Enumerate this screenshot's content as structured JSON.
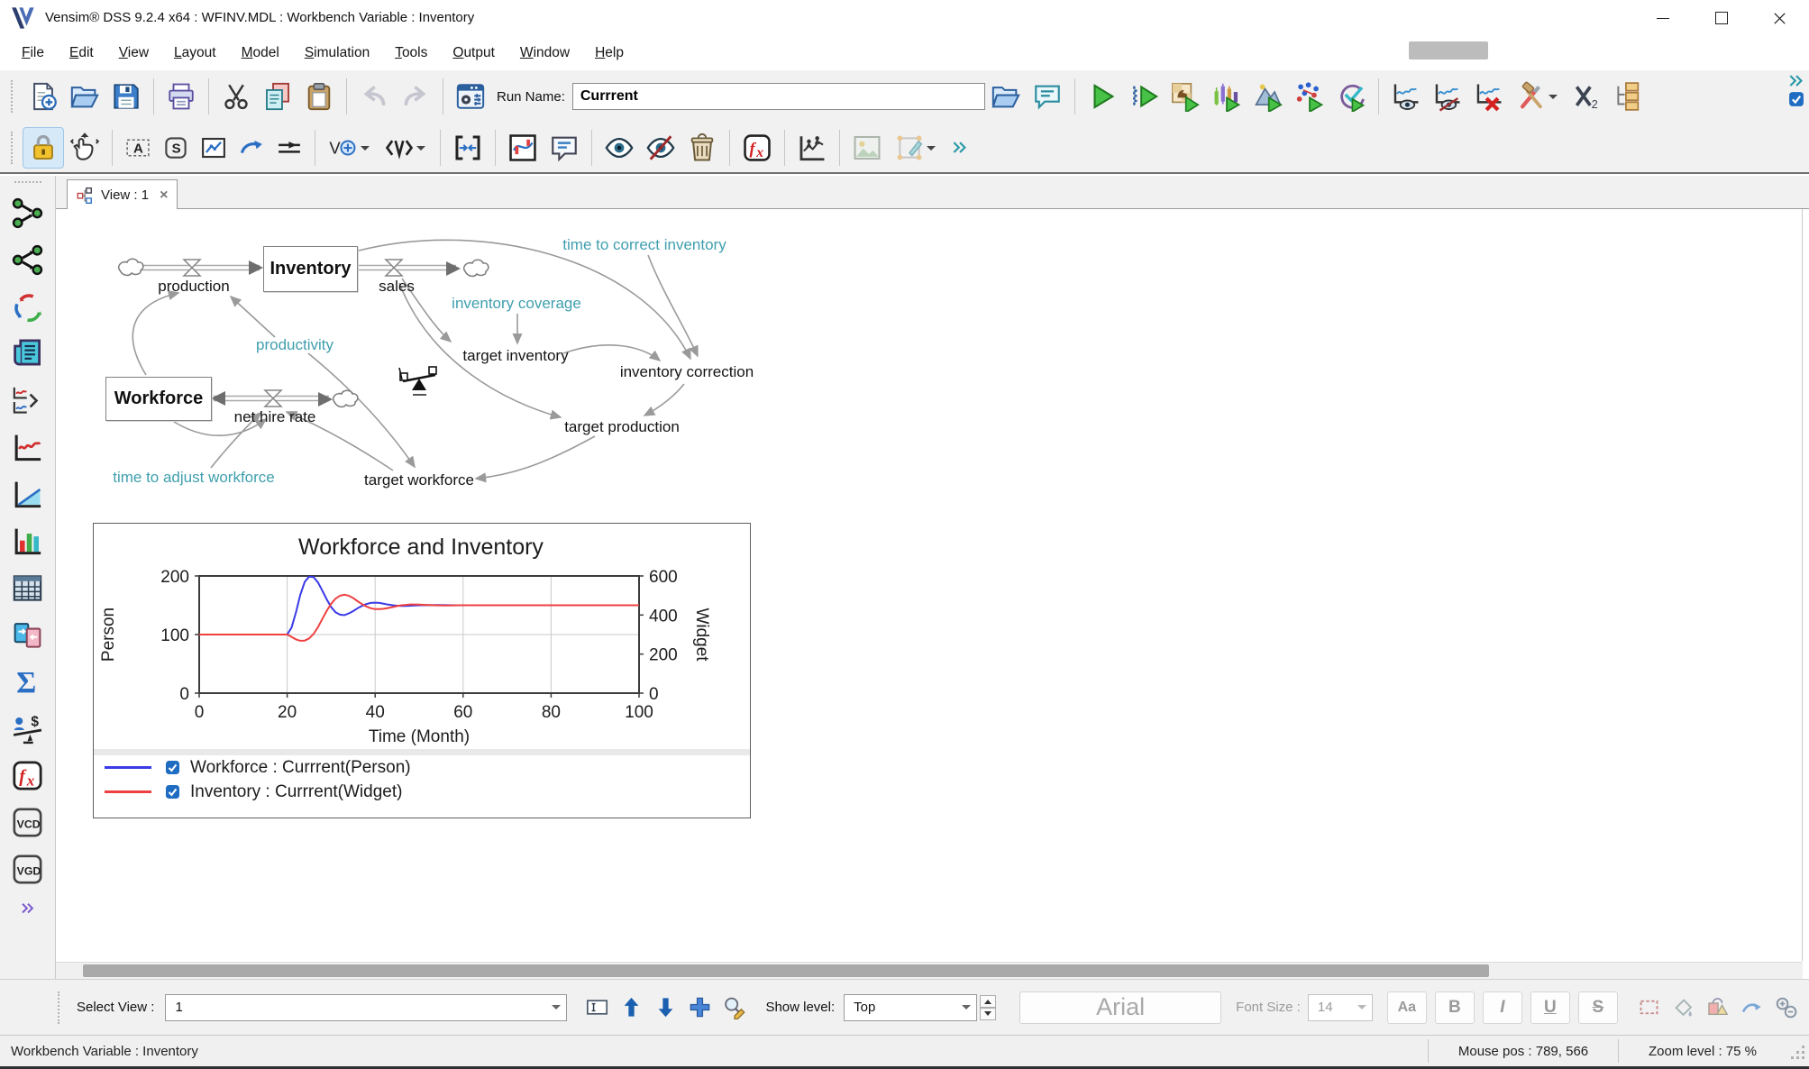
{
  "titlebar": {
    "title": "Vensim® DSS 9.2.4 x64 : WFINV.MDL : Workbench Variable : Inventory"
  },
  "menu": {
    "items": [
      "File",
      "Edit",
      "View",
      "Layout",
      "Model",
      "Simulation",
      "Tools",
      "Output",
      "Window",
      "Help"
    ]
  },
  "toolbar1": {
    "run_name_label": "Run Name:",
    "run_name_value": "Currrent",
    "icons": [
      "new-model",
      "open-model",
      "save",
      "print",
      "cut",
      "copy",
      "paste",
      "undo",
      "redo",
      "simulation-setup",
      "open-run",
      "output-notes",
      "simulate",
      "simulate-setup",
      "run-game",
      "sensitivity",
      "optimize",
      "payoff",
      "reality-check",
      "graph-show",
      "graph-hide",
      "graph-delete",
      "tools",
      "x2",
      "tree-folders",
      "overflow-chevrons",
      "toolbar-check"
    ]
  },
  "toolbar2": {
    "icons": [
      "lock",
      "move",
      "variable-tool",
      "shadow-variable-tool",
      "box-variable-tool",
      "arrow-tool",
      "rate-tool",
      "variable-merge",
      "variable-angle",
      "shadow-merge",
      "input-output-object",
      "comment-tool",
      "show",
      "hide",
      "delete",
      "equation-editor",
      "behavior-graph",
      "image-object",
      "polygon-object",
      "overflow-chevrons"
    ]
  },
  "sidebar": {
    "icons": [
      "causes-tree",
      "uses-tree",
      "loops",
      "document",
      "causes-strip",
      "graph",
      "cumulative-graph",
      "bar-graph",
      "table",
      "runs-compare",
      "statistics",
      "causes-of-balance",
      "equation",
      "vcd",
      "vgd",
      "overflow-chevrons"
    ]
  },
  "tab": {
    "label": "View : 1",
    "close_glyph": "×"
  },
  "diagram": {
    "stock_inventory": "Inventory",
    "stock_workforce": "Workforce",
    "flow_production": "production",
    "flow_sales": "sales",
    "flow_net_hire_rate": "net hire rate",
    "aux_productivity": "productivity",
    "aux_time_to_correct_inventory": "time to correct inventory",
    "aux_inventory_coverage": "inventory coverage",
    "aux_target_inventory": "target inventory",
    "aux_inventory_correction": "inventory correction",
    "aux_target_production": "target production",
    "aux_target_workforce": "target workforce",
    "aux_time_to_adjust_workforce": "time to adjust workforce",
    "colors": {
      "constant_teal": "#3f9fae",
      "variable_black": "#141414",
      "link_gray": "#9a9a9a"
    }
  },
  "chart_data": {
    "type": "line",
    "title": "Workforce and Inventory",
    "xlabel": "Time (Month)",
    "xlim": [
      0,
      100
    ],
    "x_ticks": [
      0,
      20,
      40,
      60,
      80,
      100
    ],
    "left_axis": {
      "label": "Person",
      "lim": [
        0,
        200
      ],
      "ticks": [
        0,
        100,
        200
      ]
    },
    "right_axis": {
      "label": "Widget",
      "lim": [
        0,
        600
      ],
      "ticks": [
        0,
        200,
        400,
        600
      ]
    },
    "grid": true,
    "legend_position": "bottom",
    "x": [
      0,
      5,
      10,
      15,
      20,
      21,
      22,
      23,
      24,
      25,
      26,
      27,
      28,
      29,
      30,
      31,
      32,
      33,
      34,
      35,
      36,
      37,
      38,
      39,
      40,
      41,
      42,
      43,
      44,
      45,
      46,
      47,
      48,
      49,
      50,
      52,
      54,
      56,
      58,
      60,
      65,
      70,
      75,
      80,
      85,
      90,
      95,
      100
    ],
    "series": [
      {
        "name": "Workforce : Currrent(Person)",
        "axis": "left",
        "color": "#3a3ae8",
        "checked": true,
        "y": [
          100,
          100,
          100,
          100,
          100,
          112,
          138,
          168,
          190,
          199,
          198,
          189,
          175,
          160,
          147,
          138,
          134,
          133,
          136,
          140,
          145,
          149,
          152,
          154,
          154.5,
          154,
          152.5,
          151,
          150,
          149.2,
          148.8,
          148.8,
          149.2,
          149.6,
          150,
          150.2,
          150.3,
          150.1,
          150,
          150,
          150,
          150,
          150,
          150,
          150,
          150,
          150,
          150
        ]
      },
      {
        "name": "Inventory : Currrent(Widget)",
        "axis": "right",
        "color": "#ee4040",
        "checked": true,
        "y": [
          300,
          300,
          300,
          300,
          300,
          288,
          275,
          268,
          269,
          280,
          303,
          338,
          380,
          422,
          458,
          484,
          499,
          504,
          499,
          487,
          471,
          456,
          444,
          435,
          430,
          430,
          432,
          436,
          441,
          446,
          450,
          452,
          454,
          454,
          453,
          451,
          449.5,
          449,
          449.5,
          450,
          450,
          450,
          450,
          450,
          450,
          450,
          450,
          450
        ]
      }
    ]
  },
  "bottom_toolbar": {
    "select_view_label": "Select View :",
    "select_view_value": "1",
    "show_level_label": "Show level:",
    "show_level_value": "Top",
    "font_name": "Arial",
    "font_size_label": "Font Size :",
    "font_size_value": "14",
    "buttons": {
      "aa": "Aa",
      "bold": "B",
      "italic": "I",
      "underline": "U",
      "strike": "S"
    }
  },
  "status_bar": {
    "workbench": "Workbench Variable : Inventory",
    "mouse_pos": "Mouse pos : 789, 566",
    "zoom_level": "Zoom level : 75 %"
  }
}
